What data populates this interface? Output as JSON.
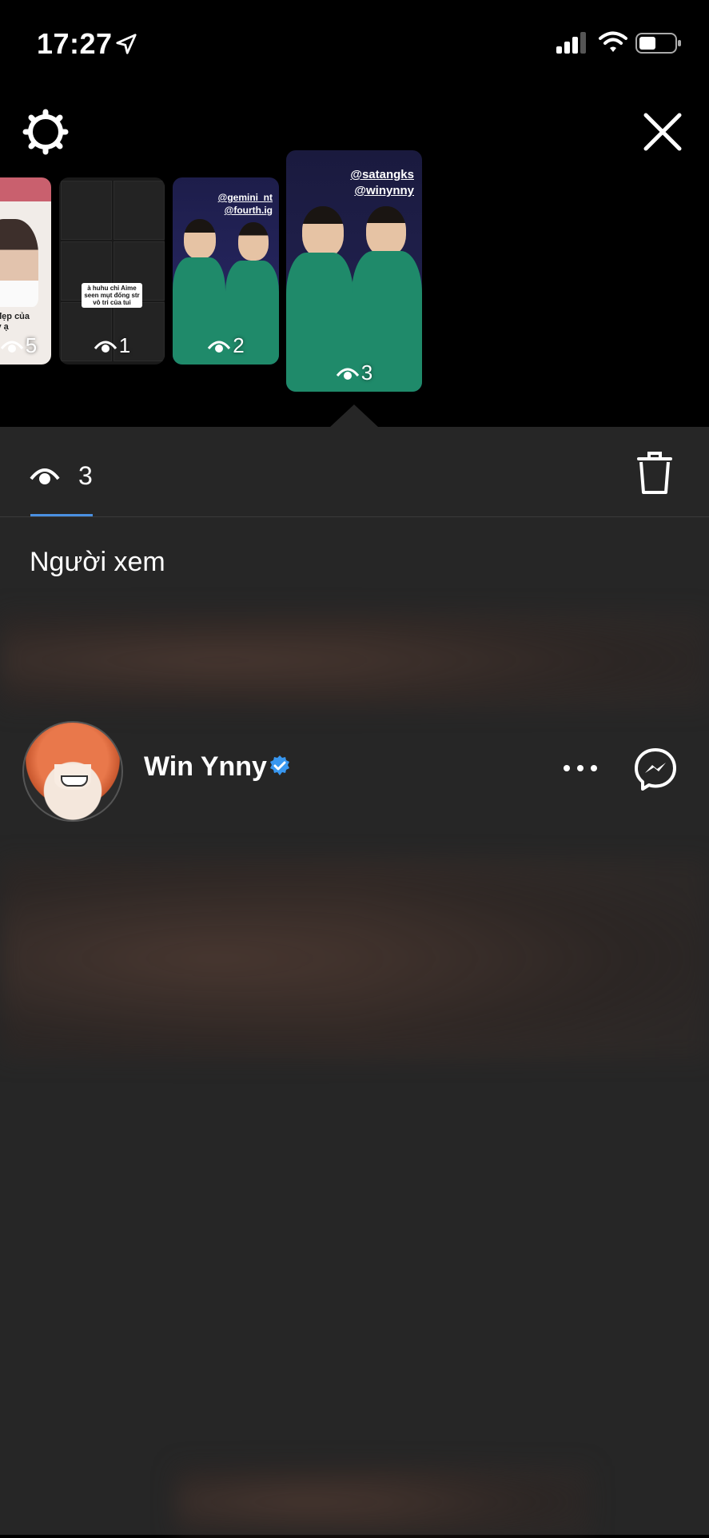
{
  "status_bar": {
    "time": "17:27",
    "icons": [
      "location-arrow-icon",
      "cellular-signal-icon",
      "wifi-icon",
      "battery-icon"
    ]
  },
  "top_actions": {
    "settings_icon": "gear-icon",
    "close_icon": "close-icon"
  },
  "stories": [
    {
      "views": "5",
      "caption": "rẻ đẹp của\nnny ạ"
    },
    {
      "views": "1",
      "note": "à huhu chỉ Aime seen mụt đống str vô tri của tui"
    },
    {
      "views": "2",
      "mentions": [
        "@gemini_nt",
        "@fourth.ig"
      ]
    },
    {
      "views": "3",
      "mentions": [
        "@satangks",
        "@winynny"
      ],
      "selected": true
    }
  ],
  "toolbar": {
    "view_count": "3",
    "delete_icon": "trash-icon"
  },
  "viewers": {
    "title": "Người xem",
    "items": [
      {
        "name": "Win Ynny",
        "verified": true
      }
    ]
  },
  "colors": {
    "background": "#000000",
    "panel": "#262626",
    "accent": "#4a90e2",
    "verified": "#3897f0"
  }
}
